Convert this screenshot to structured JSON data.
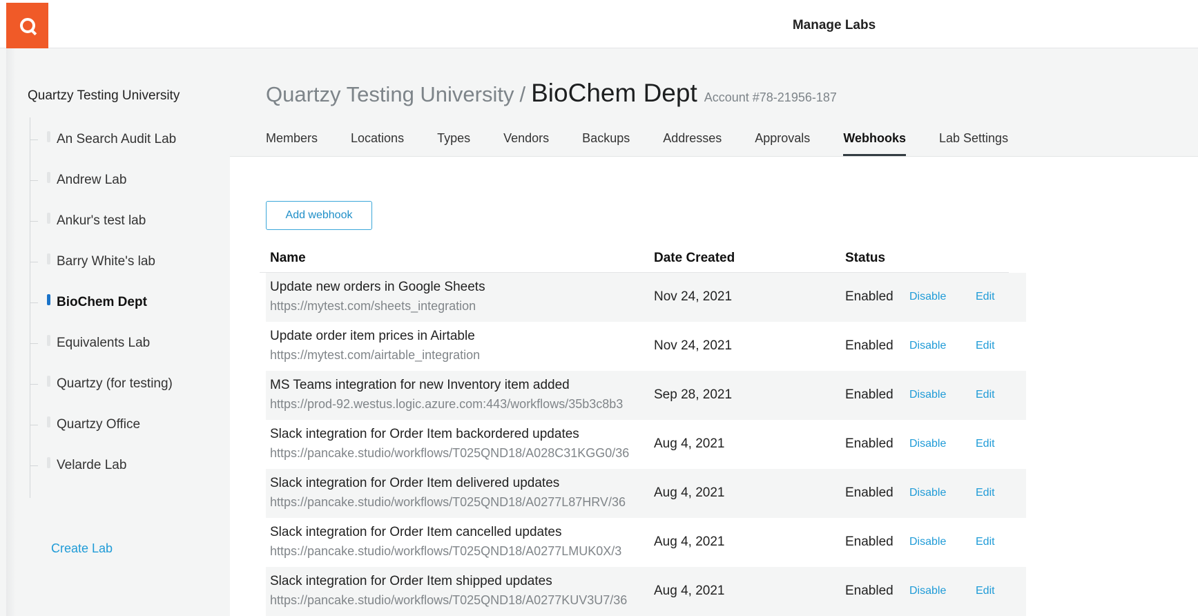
{
  "colors": {
    "brand": "#f05a28",
    "link": "#1f9bd7",
    "active_indicator": "#1a73c9"
  },
  "topbar": {
    "logo_icon": "quartzy-logo-icon",
    "title": "Manage Labs"
  },
  "sidebar": {
    "org_name": "Quartzy Testing University",
    "labs": [
      {
        "label": "An Search Audit Lab",
        "active": false
      },
      {
        "label": "Andrew Lab",
        "active": false
      },
      {
        "label": "Ankur's test lab",
        "active": false
      },
      {
        "label": "Barry White's lab",
        "active": false
      },
      {
        "label": "BioChem Dept",
        "active": true
      },
      {
        "label": "Equivalents Lab",
        "active": false
      },
      {
        "label": "Quartzy (for testing)",
        "active": false
      },
      {
        "label": "Quartzy Office",
        "active": false
      },
      {
        "label": "Velarde Lab",
        "active": false
      }
    ],
    "create_lab": "Create Lab"
  },
  "header": {
    "parent": "Quartzy Testing University",
    "separator": "/",
    "current": "BioChem Dept",
    "account": "Account #78-21956-187"
  },
  "tabs": [
    {
      "label": "Members",
      "active": false
    },
    {
      "label": "Locations",
      "active": false
    },
    {
      "label": "Types",
      "active": false
    },
    {
      "label": "Vendors",
      "active": false
    },
    {
      "label": "Backups",
      "active": false
    },
    {
      "label": "Addresses",
      "active": false
    },
    {
      "label": "Approvals",
      "active": false
    },
    {
      "label": "Webhooks",
      "active": true
    },
    {
      "label": "Lab Settings",
      "active": false
    }
  ],
  "webhooks": {
    "add_button": "Add webhook",
    "columns": {
      "name": "Name",
      "date": "Date Created",
      "status": "Status"
    },
    "rows": [
      {
        "name": "Update new orders in Google Sheets",
        "url": "https://mytest.com/sheets_integration",
        "date": "Nov 24, 2021",
        "status": "Enabled",
        "disable": "Disable",
        "edit": "Edit"
      },
      {
        "name": "Update order item prices in Airtable",
        "url": "https://mytest.com/airtable_integration",
        "date": "Nov 24, 2021",
        "status": "Enabled",
        "disable": "Disable",
        "edit": "Edit"
      },
      {
        "name": "MS Teams integration for new Inventory item added",
        "url": "https://prod-92.westus.logic.azure.com:443/workflows/35b3c8b3",
        "date": "Sep 28, 2021",
        "status": "Enabled",
        "disable": "Disable",
        "edit": "Edit"
      },
      {
        "name": "Slack integration for Order Item backordered updates",
        "url": "https://pancake.studio/workflows/T025QND18/A028C31KGG0/36",
        "date": "Aug 4, 2021",
        "status": "Enabled",
        "disable": "Disable",
        "edit": "Edit"
      },
      {
        "name": "Slack integration for Order Item delivered updates",
        "url": "https://pancake.studio/workflows/T025QND18/A0277L87HRV/36",
        "date": "Aug 4, 2021",
        "status": "Enabled",
        "disable": "Disable",
        "edit": "Edit"
      },
      {
        "name": "Slack integration for Order Item cancelled updates",
        "url": "https://pancake.studio/workflows/T025QND18/A0277LMUK0X/3",
        "date": "Aug 4, 2021",
        "status": "Enabled",
        "disable": "Disable",
        "edit": "Edit"
      },
      {
        "name": "Slack integration for Order Item shipped updates",
        "url": "https://pancake.studio/workflows/T025QND18/A0277KUV3U7/36",
        "date": "Aug 4, 2021",
        "status": "Enabled",
        "disable": "Disable",
        "edit": "Edit"
      }
    ]
  }
}
